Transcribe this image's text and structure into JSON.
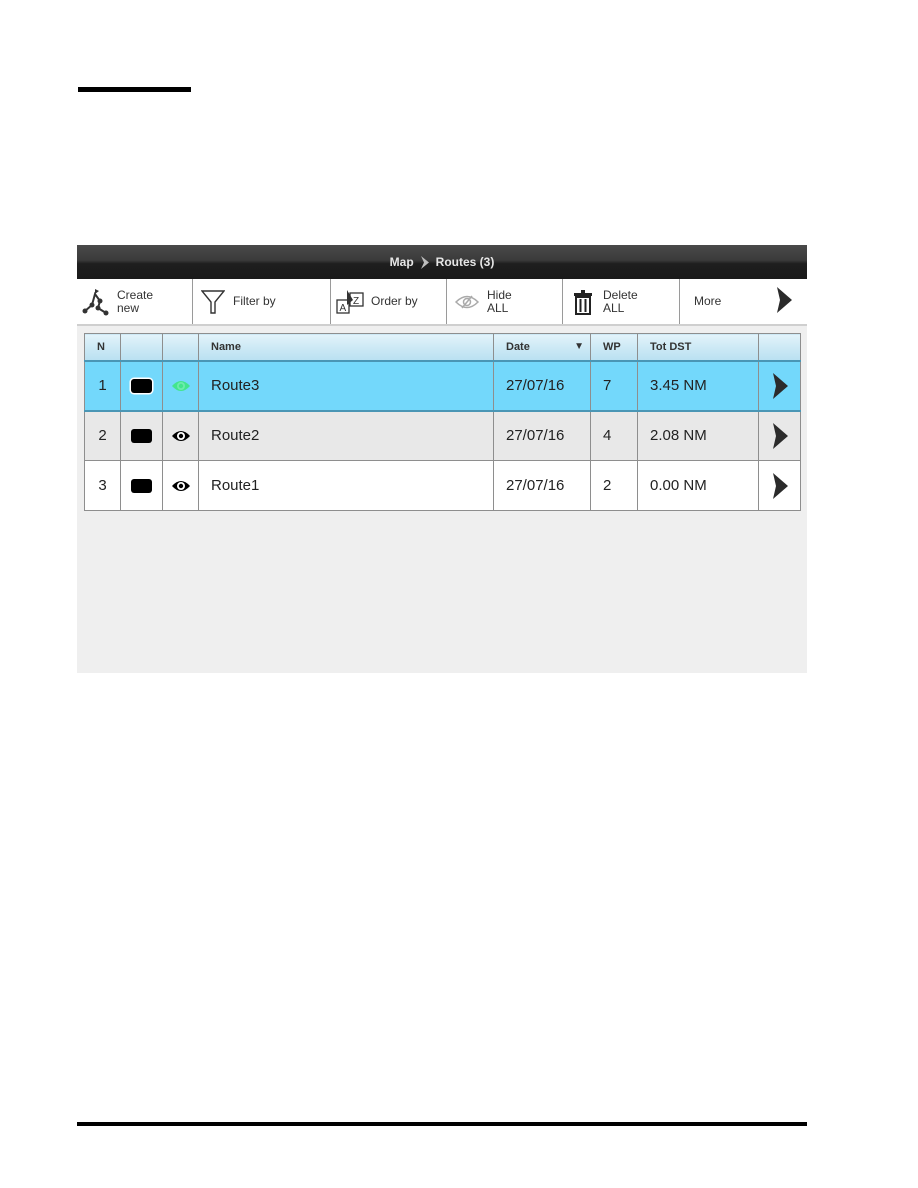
{
  "breadcrumb": {
    "root": "Map",
    "current": "Routes (3)"
  },
  "toolbar": {
    "create": {
      "line1": "Create",
      "line2": "new",
      "icon": "route-create-icon"
    },
    "filter": {
      "line1": "Filter by",
      "icon": "funnel-icon"
    },
    "order": {
      "line1": "Order by",
      "icon": "sort-az-icon"
    },
    "hide": {
      "line1": "Hide",
      "line2": "ALL",
      "icon": "eye-hide-icon"
    },
    "delete": {
      "line1": "Delete",
      "line2": "ALL",
      "icon": "trash-icon"
    },
    "more": {
      "line1": "More",
      "icon": "chevron-right-icon"
    }
  },
  "table": {
    "columns": {
      "n": "N",
      "color": "",
      "visible": "",
      "name": "Name",
      "date": "Date",
      "date_sort": "▼",
      "wp": "WP",
      "dist": "Tot DST",
      "go": ""
    },
    "rows": [
      {
        "n": "1",
        "color": "#000000",
        "visible_icon": "eye-icon",
        "visible_color": "#3be87a",
        "name": "Route3",
        "date": "27/07/16",
        "wp": "7",
        "dist": "3.45 NM",
        "selected": true
      },
      {
        "n": "2",
        "color": "#000000",
        "visible_icon": "eye-icon",
        "visible_color": "#000000",
        "name": "Route2",
        "date": "27/07/16",
        "wp": "4",
        "dist": "2.08 NM",
        "selected": false
      },
      {
        "n": "3",
        "color": "#000000",
        "visible_icon": "eye-icon",
        "visible_color": "#000000",
        "name": "Route1",
        "date": "27/07/16",
        "wp": "2",
        "dist": "0.00 NM",
        "selected": false
      }
    ]
  },
  "colors": {
    "selected_row": "#73d8fb",
    "alt_row": "#e8e8e8",
    "titlebar": "#2a2a2a",
    "active_eye": "#3be87a"
  }
}
